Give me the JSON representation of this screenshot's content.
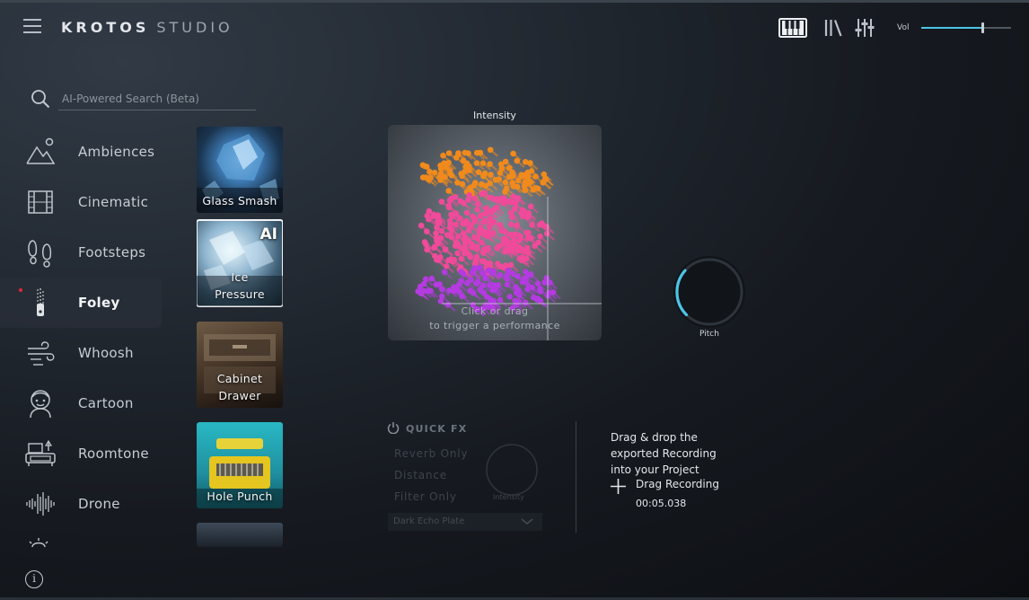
{
  "app": {
    "brand_bold": "KROTOS",
    "brand_light": "STUDIO"
  },
  "header": {
    "icons": [
      "keyboard-icon",
      "library-icon",
      "mixer-sliders-icon"
    ],
    "volume_label": "Vol",
    "volume_level": 0.68,
    "accent_color": "#4cc4e6"
  },
  "search": {
    "placeholder": "AI-Powered Search (Beta)"
  },
  "sidebar": {
    "items": [
      {
        "label": "Ambiences",
        "icon": "mountain-icon"
      },
      {
        "label": "Cinematic",
        "icon": "film-strip-icon"
      },
      {
        "label": "Footsteps",
        "icon": "footprints-icon"
      },
      {
        "label": "Foley",
        "icon": "zipper-icon",
        "active": true
      },
      {
        "label": "Whoosh",
        "icon": "wind-icon"
      },
      {
        "label": "Cartoon",
        "icon": "cartoon-face-icon"
      },
      {
        "label": "Roomtone",
        "icon": "sofa-icon"
      },
      {
        "label": "Drone",
        "icon": "waveform-icon"
      }
    ]
  },
  "presets": {
    "tiles": [
      {
        "label": "Glass Smash"
      },
      {
        "label1": "Ice",
        "label2": "Pressure",
        "badge": "AI",
        "selected": true
      },
      {
        "label1": "Cabinet",
        "label2": "Drawer"
      },
      {
        "label": "Hole Punch"
      }
    ]
  },
  "pad": {
    "title": "Intensity",
    "hint_line1": "Click or drag",
    "hint_line2": "to trigger a performance",
    "colors": {
      "orange": "#f08a1c",
      "pink": "#f04a9a",
      "purple": "#b33be0"
    }
  },
  "pitch": {
    "label": "Pitch",
    "level": 0.32
  },
  "quick_fx": {
    "title": "QUICK FX",
    "options": [
      "Reverb Only",
      "Distance",
      "Filter Only"
    ],
    "knob_label": "Intensity",
    "preset": "Dark Echo Plate"
  },
  "export": {
    "line1": "Drag & drop the",
    "line2": "exported Recording",
    "line3": "into your Project",
    "drag_label": "Drag Recording",
    "timecode": "00:05.038"
  }
}
